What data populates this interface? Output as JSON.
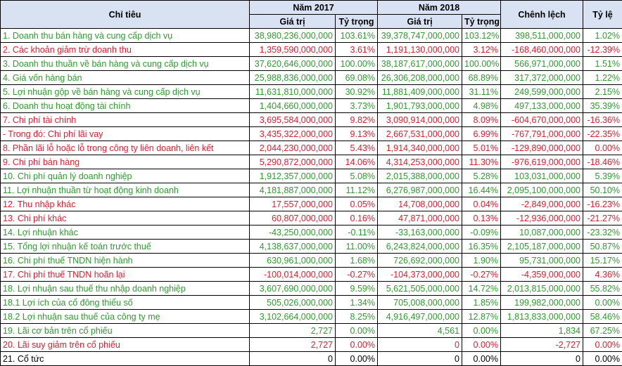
{
  "header": {
    "indicator": "Chỉ tiêu",
    "year1": "Năm 2017",
    "year2": "Năm 2018",
    "difference": "Chênh lệch",
    "ratio": "Tỷ lệ",
    "value": "Giá trị",
    "proportion": "Tỷ trọng"
  },
  "colors": {
    "green": "#2e9b2e",
    "red": "#e8192c",
    "header_bg": "#d9e2f3"
  },
  "rows": [
    {
      "label": "1. Doanh thu bán hàng và cung cấp dịch vụ",
      "v2017": "38,980,236,000,000",
      "p2017": "103.61%",
      "v2018": "39,378,747,000,000",
      "p2018": "103.12%",
      "diff": "398,511,000,000",
      "ratio": "1.02%",
      "color": "g"
    },
    {
      "label": "2. Các khoản giảm trừ doanh thu",
      "v2017": "1,359,590,000,000",
      "p2017": "3.61%",
      "v2018": "1,191,130,000,000",
      "p2018": "3.12%",
      "diff": "-168,460,000,000",
      "ratio": "-12.39%",
      "color": "r"
    },
    {
      "label": "3. Doanh thu thuần về bán hàng và cung cấp dịch vụ",
      "v2017": "37,620,646,000,000",
      "p2017": "100.00%",
      "v2018": "38,187,617,000,000",
      "p2018": "100.00%",
      "diff": "566,971,000,000",
      "ratio": "1.51%",
      "color": "g"
    },
    {
      "label": "4. Giá vốn hàng bán",
      "v2017": "25,988,836,000,000",
      "p2017": "69.08%",
      "v2018": "26,306,208,000,000",
      "p2018": "68.89%",
      "diff": "317,372,000,000",
      "ratio": "1.22%",
      "color": "g"
    },
    {
      "label": "5. Lợi nhuận gộp về bán hàng và cung cấp dịch vụ",
      "v2017": "11,631,810,000,000",
      "p2017": "30.92%",
      "v2018": "11,881,409,000,000",
      "p2018": "31.11%",
      "diff": "249,599,000,000",
      "ratio": "2.15%",
      "color": "g"
    },
    {
      "label": "6. Doanh thu hoạt động tài chính",
      "v2017": "1,404,660,000,000",
      "p2017": "3.73%",
      "v2018": "1,901,793,000,000",
      "p2018": "4.98%",
      "diff": "497,133,000,000",
      "ratio": "35.39%",
      "color": "g"
    },
    {
      "label": "7. Chi phí tài chính",
      "v2017": "3,695,584,000,000",
      "p2017": "9.82%",
      "v2018": "3,090,914,000,000",
      "p2018": "8.09%",
      "diff": "-604,670,000,000",
      "ratio": "-16.36%",
      "color": "r"
    },
    {
      "label": " - Trong đó: Chi phí lãi vay",
      "v2017": "3,435,322,000,000",
      "p2017": "9.13%",
      "v2018": "2,667,531,000,000",
      "p2018": "6.99%",
      "diff": "-767,791,000,000",
      "ratio": "-22.35%",
      "color": "r"
    },
    {
      "label": "8. Phần lãi lỗ hoặc lỗ trong công ty liên doanh, liên kết",
      "v2017": "2,044,230,000,000",
      "p2017": "5.43%",
      "v2018": "1,914,340,000,000",
      "p2018": "5.01%",
      "diff": "-129,890,000,000",
      "ratio": "0.00%",
      "color": "r"
    },
    {
      "label": "9. Chi phí bán hàng",
      "v2017": "5,290,872,000,000",
      "p2017": "14.06%",
      "v2018": "4,314,253,000,000",
      "p2018": "11.30%",
      "diff": "-976,619,000,000",
      "ratio": "-18.46%",
      "color": "r"
    },
    {
      "label": "10. Chi phí quản lý doanh nghiệp",
      "v2017": "1,912,357,000,000",
      "p2017": "5.08%",
      "v2018": "2,015,388,000,000",
      "p2018": "5.28%",
      "diff": "103,031,000,000",
      "ratio": "5.39%",
      "color": "g"
    },
    {
      "label": "11. Lợi nhuận thuần từ hoạt động kinh doanh",
      "v2017": "4,181,887,000,000",
      "p2017": "11.12%",
      "v2018": "6,276,987,000,000",
      "p2018": "16.44%",
      "diff": "2,095,100,000,000",
      "ratio": "50.10%",
      "color": "g"
    },
    {
      "label": "12. Thu nhập khác",
      "v2017": "17,557,000,000",
      "p2017": "0.05%",
      "v2018": "14,708,000,000",
      "p2018": "0.04%",
      "diff": "-2,849,000,000",
      "ratio": "-16.23%",
      "color": "r"
    },
    {
      "label": "13. Chi phí khác",
      "v2017": "60,807,000,000",
      "p2017": "0.16%",
      "v2018": "47,871,000,000",
      "p2018": "0.13%",
      "diff": "-12,936,000,000",
      "ratio": "-21.27%",
      "color": "r"
    },
    {
      "label": "14. Lợi nhuận khác",
      "v2017": "-43,250,000,000",
      "p2017": "-0.11%",
      "v2018": "-33,163,000,000",
      "p2018": "-0.09%",
      "diff": "10,087,000,000",
      "ratio": "-23.32%",
      "color": "g"
    },
    {
      "label": "15. Tổng lợi nhuận kế toán trước thuế",
      "v2017": "4,138,637,000,000",
      "p2017": "11.00%",
      "v2018": "6,243,824,000,000",
      "p2018": "16.35%",
      "diff": "2,105,187,000,000",
      "ratio": "50.87%",
      "color": "g"
    },
    {
      "label": "16. Chi phí thuế TNDN hiện hành",
      "v2017": "630,961,000,000",
      "p2017": "1.68%",
      "v2018": "726,692,000,000",
      "p2018": "1.90%",
      "diff": "95,731,000,000",
      "ratio": "15.17%",
      "color": "g"
    },
    {
      "label": "17. Chi phí thuế TNDN hoãn lại",
      "v2017": "-100,014,000,000",
      "p2017": "-0.27%",
      "v2018": "-104,373,000,000",
      "p2018": "-0.27%",
      "diff": "-4,359,000,000",
      "ratio": "4.36%",
      "color": "r"
    },
    {
      "label": "18. Lợi nhuận sau thuế thu nhập doanh nghiệp",
      "v2017": "3,607,690,000,000",
      "p2017": "9.59%",
      "v2018": "5,621,505,000,000",
      "p2018": "14.72%",
      "diff": "2,013,815,000,000",
      "ratio": "55.82%",
      "color": "g"
    },
    {
      "label": "18.1 Lợi ích của cổ đông thiểu số",
      "v2017": "505,026,000,000",
      "p2017": "1.34%",
      "v2018": "705,008,000,000",
      "p2018": "1.85%",
      "diff": "199,982,000,000",
      "ratio": "0.00%",
      "color": "g"
    },
    {
      "label": "18.2 Lợi nhuận sau thuế của công ty mẹ",
      "v2017": "3,102,664,000,000",
      "p2017": "8.25%",
      "v2018": "4,916,497,000,000",
      "p2018": "12.87%",
      "diff": "1,813,833,000,000",
      "ratio": "58.46%",
      "color": "g"
    },
    {
      "label": "19. Lãi cơ bản trên cổ phiếu",
      "v2017": "2,727",
      "p2017": "0.00%",
      "v2018": "4,561",
      "p2018": "0.00%",
      "diff": "1,834",
      "ratio": "67.25%",
      "color": "g"
    },
    {
      "label": "20. Lãi suy giảm trên cổ phiếu",
      "v2017": "2,727",
      "p2017": "0.00%",
      "v2018": "0",
      "p2018": "0.00%",
      "diff": "-2,727",
      "ratio": "0.00%",
      "color": "r"
    },
    {
      "label": "21. Cổ tức",
      "v2017": "0",
      "p2017": "0.00%",
      "v2018": "0",
      "p2018": "0.00%",
      "diff": "0",
      "ratio": "0.00%",
      "color": "k"
    }
  ]
}
